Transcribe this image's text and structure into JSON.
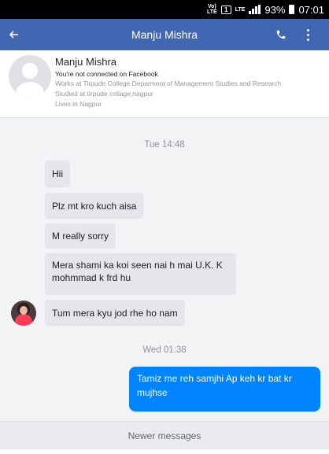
{
  "status_bar": {
    "volte_label": "Vo)\nLTE",
    "sim_label": "1",
    "lte_label": "LTE",
    "battery_percent": "93%",
    "time": "07:01"
  },
  "app_bar": {
    "title": "Manju Mishra",
    "back_icon": "back-arrow-icon",
    "call_icon": "phone-icon",
    "menu_icon": "more-vert-icon",
    "color": "#4267b2"
  },
  "profile": {
    "name": "Manju Mishra",
    "connection": "You're not connected on Facebook",
    "work": "Works at Tirpude College Deparment of Management Studies and Research",
    "study": "Studied at tirpude collage,nagpur",
    "lives": "Lives in Nagpur"
  },
  "conversation": {
    "timestamp_1": "Tue 14:48",
    "incoming": [
      "Hii",
      "Plz mt kro kuch aisa",
      "M really sorry",
      "Mera shami ka koi seen nai h mai U.K. K mohmmad k frd hu",
      "Tum mera kyu jod rhe ho nam"
    ],
    "timestamp_2": "Wed 01:38",
    "outgoing": [
      "Tamiz me reh samjhi Ap keh kr bat kr mujhse"
    ],
    "outgoing_color": "#0084ff"
  },
  "footer": {
    "newer_label": "Newer messages"
  }
}
